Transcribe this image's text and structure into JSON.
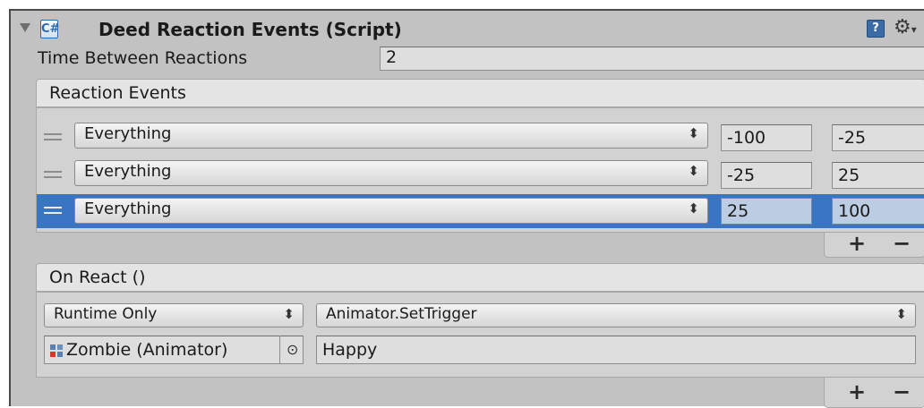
{
  "component": {
    "title": "Deed Reaction Events (Script)",
    "script_icon": "C#-script-icon",
    "help_icon": "?",
    "gear_icon": "⚙",
    "gear_caret": "▾"
  },
  "time_between_reactions": {
    "label": "Time Between Reactions",
    "value": "2"
  },
  "reaction_events": {
    "header": "Reaction Events",
    "rows": [
      {
        "dropdown": "Everything",
        "min": "-100",
        "max": "-25",
        "selected": false
      },
      {
        "dropdown": "Everything",
        "min": "-25",
        "max": "25",
        "selected": false
      },
      {
        "dropdown": "Everything",
        "min": "25",
        "max": "100",
        "selected": true
      }
    ],
    "add_label": "+",
    "remove_label": "−"
  },
  "on_react": {
    "header": "On React ()",
    "call_state": "Runtime Only",
    "function": "Animator.SetTrigger",
    "target_object": "Zombie (Animator)",
    "argument": "Happy",
    "add_label": "+",
    "remove_label": "−"
  },
  "colors": {
    "panel_bg": "#c2c2c2",
    "selection": "#3a75c4"
  }
}
